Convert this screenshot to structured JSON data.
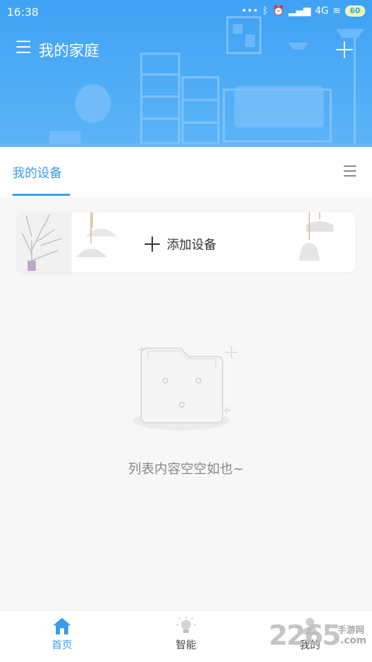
{
  "status_bar": {
    "time": "16:38",
    "network": "4G",
    "battery": "60",
    "icons": [
      "dots-icon",
      "bluetooth-icon",
      "alarm-icon",
      "signal-icon",
      "wifi-icon",
      "battery-icon"
    ]
  },
  "header": {
    "title": "我的家庭",
    "menu_icon": "hamburger-icon",
    "add_icon": "plus-icon"
  },
  "tabs": {
    "active_label": "我的设备",
    "list_icon": "list-icon"
  },
  "add_device": {
    "label": "添加设备"
  },
  "empty_state": {
    "message": "列表内容空空如也~",
    "icon": "empty-folder-icon"
  },
  "bottom_nav": [
    {
      "label": "首页",
      "icon": "home-icon",
      "active": true
    },
    {
      "label": "智能",
      "icon": "bulb-icon",
      "active": false
    },
    {
      "label": "我的",
      "icon": "user-icon",
      "active": false
    }
  ],
  "watermark": {
    "number": "2265",
    "brand": "手游网",
    "domain": ".com"
  },
  "colors": {
    "header_blue": "#3fa2f5",
    "accent": "#3a9be8",
    "background": "#f7f7f7"
  }
}
